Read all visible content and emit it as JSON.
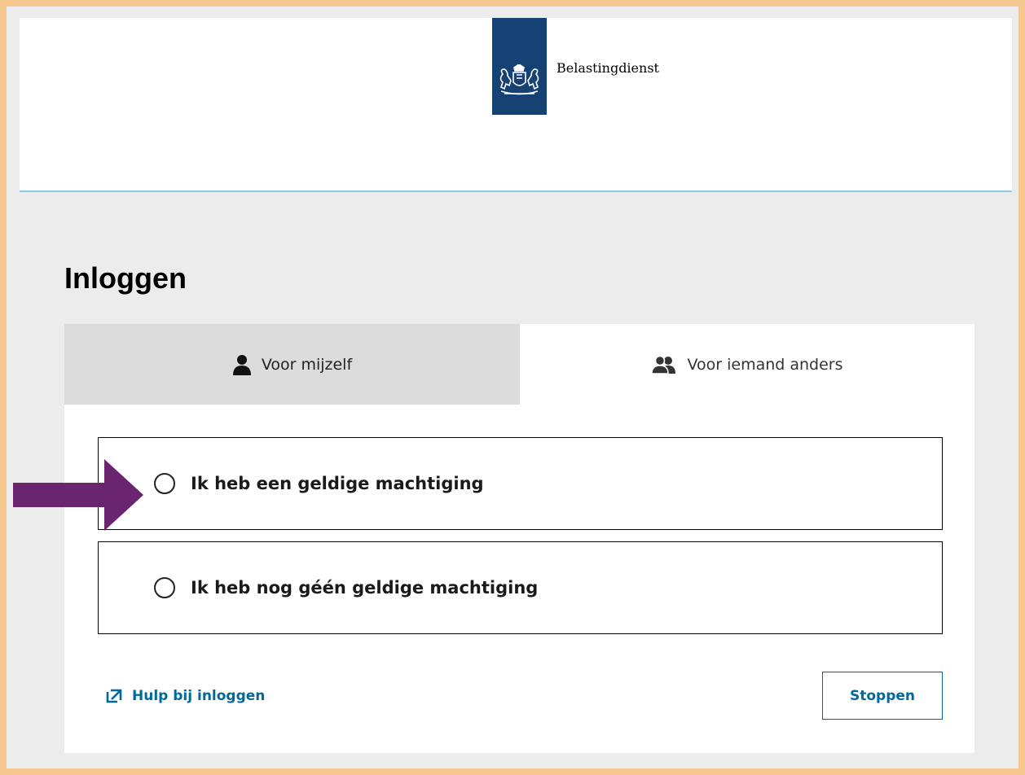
{
  "header": {
    "brand": "Belastingdienst",
    "brand_color": "#154273"
  },
  "page": {
    "title": "Inloggen"
  },
  "tabs": [
    {
      "label": "Voor mijzelf",
      "icon": "person-icon",
      "active": true
    },
    {
      "label": "Voor iemand anders",
      "icon": "persons-icon",
      "active": false
    }
  ],
  "options": [
    {
      "label": "Ik heb een geldige machtiging",
      "checked": false
    },
    {
      "label": "Ik heb nog géén geldige machtiging",
      "checked": false
    }
  ],
  "footer": {
    "help_label": "Hulp bij inloggen",
    "help_icon": "external-link-icon",
    "stop_label": "Stoppen"
  },
  "colors": {
    "outer_border": "#f6c78e",
    "link": "#01689b",
    "header_rule": "#8fc8e6",
    "arrow": "#6b2470"
  }
}
